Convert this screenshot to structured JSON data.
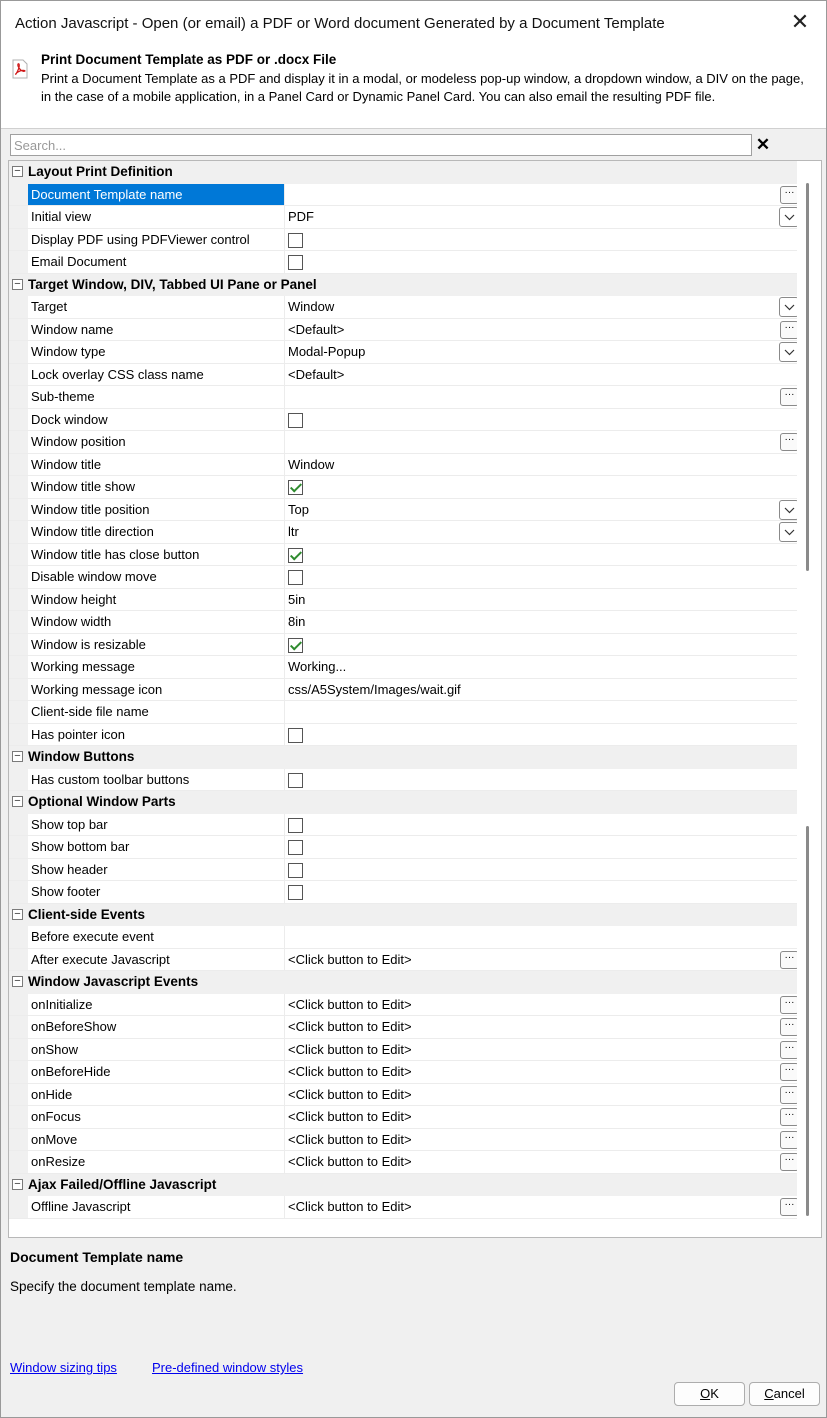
{
  "window": {
    "title": "Action Javascript - Open (or email) a PDF or Word document Generated by a Document Template"
  },
  "header": {
    "title": "Print Document Template as PDF or .docx File",
    "description": "Print a Document Template as a PDF and display it in a modal, or modeless pop-up window, a dropdown window, a DIV on the page, in the case of a mobile application, in a Panel Card or Dynamic Panel Card. You can also email the resulting PDF file."
  },
  "search": {
    "placeholder": "Search..."
  },
  "grid": {
    "rows": [
      {
        "kind": "cat",
        "label": "Layout Print Definition"
      },
      {
        "kind": "prop",
        "name": "Document Template name",
        "value": "",
        "control": "ellipsis",
        "selected": true
      },
      {
        "kind": "prop",
        "name": "Initial view",
        "value": "PDF",
        "control": "dropdown"
      },
      {
        "kind": "prop",
        "name": "Display PDF using PDFViewer control",
        "control": "checkbox",
        "checked": false
      },
      {
        "kind": "prop",
        "name": "Email Document",
        "control": "checkbox",
        "checked": false
      },
      {
        "kind": "cat",
        "label": "Target Window, DIV, Tabbed UI Pane or Panel"
      },
      {
        "kind": "prop",
        "name": "Target",
        "value": "Window",
        "control": "dropdown"
      },
      {
        "kind": "prop",
        "name": "Window name",
        "value": "<Default>",
        "control": "ellipsis"
      },
      {
        "kind": "prop",
        "name": "Window type",
        "value": "Modal-Popup",
        "control": "dropdown"
      },
      {
        "kind": "prop",
        "name": "Lock overlay CSS class name",
        "value": "<Default>"
      },
      {
        "kind": "prop",
        "name": "Sub-theme",
        "value": "",
        "control": "ellipsis"
      },
      {
        "kind": "prop",
        "name": "Dock window",
        "control": "checkbox",
        "checked": false
      },
      {
        "kind": "prop",
        "name": "Window position",
        "value": "",
        "control": "ellipsis"
      },
      {
        "kind": "prop",
        "name": "Window title",
        "value": "Window"
      },
      {
        "kind": "prop",
        "name": "Window title show",
        "control": "checkbox",
        "checked": true
      },
      {
        "kind": "prop",
        "name": "Window title position",
        "value": "Top",
        "control": "dropdown"
      },
      {
        "kind": "prop",
        "name": "Window title direction",
        "value": "ltr",
        "control": "dropdown"
      },
      {
        "kind": "prop",
        "name": "Window title has close button",
        "control": "checkbox",
        "checked": true
      },
      {
        "kind": "prop",
        "name": "Disable window move",
        "control": "checkbox",
        "checked": false
      },
      {
        "kind": "prop",
        "name": "Window height",
        "value": "5in"
      },
      {
        "kind": "prop",
        "name": "Window width",
        "value": "8in"
      },
      {
        "kind": "prop",
        "name": "Window is resizable",
        "control": "checkbox",
        "checked": true
      },
      {
        "kind": "prop",
        "name": "Working message",
        "value": "Working..."
      },
      {
        "kind": "prop",
        "name": "Working message icon",
        "value": "css/A5System/Images/wait.gif"
      },
      {
        "kind": "prop",
        "name": "Client-side file name",
        "value": ""
      },
      {
        "kind": "prop",
        "name": "Has pointer icon",
        "control": "checkbox",
        "checked": false
      },
      {
        "kind": "cat",
        "label": "Window Buttons"
      },
      {
        "kind": "prop",
        "name": "Has custom toolbar buttons",
        "control": "checkbox",
        "checked": false
      },
      {
        "kind": "cat",
        "label": "Optional Window Parts"
      },
      {
        "kind": "prop",
        "name": "Show top bar",
        "control": "checkbox",
        "checked": false
      },
      {
        "kind": "prop",
        "name": "Show bottom bar",
        "control": "checkbox",
        "checked": false
      },
      {
        "kind": "prop",
        "name": "Show header",
        "control": "checkbox",
        "checked": false
      },
      {
        "kind": "prop",
        "name": "Show footer",
        "control": "checkbox",
        "checked": false
      },
      {
        "kind": "cat",
        "label": "Client-side Events"
      },
      {
        "kind": "prop",
        "name": "Before execute event",
        "value": ""
      },
      {
        "kind": "prop",
        "name": "After execute Javascript",
        "value": "<Click button to Edit>",
        "control": "ellipsis"
      },
      {
        "kind": "cat",
        "label": "Window Javascript Events"
      },
      {
        "kind": "prop",
        "name": "onInitialize",
        "value": "<Click button to Edit>",
        "control": "ellipsis"
      },
      {
        "kind": "prop",
        "name": "onBeforeShow",
        "value": "<Click button to Edit>",
        "control": "ellipsis"
      },
      {
        "kind": "prop",
        "name": "onShow",
        "value": "<Click button to Edit>",
        "control": "ellipsis"
      },
      {
        "kind": "prop",
        "name": "onBeforeHide",
        "value": "<Click button to Edit>",
        "control": "ellipsis"
      },
      {
        "kind": "prop",
        "name": "onHide",
        "value": "<Click button to Edit>",
        "control": "ellipsis"
      },
      {
        "kind": "prop",
        "name": "onFocus",
        "value": "<Click button to Edit>",
        "control": "ellipsis"
      },
      {
        "kind": "prop",
        "name": "onMove",
        "value": "<Click button to Edit>",
        "control": "ellipsis"
      },
      {
        "kind": "prop",
        "name": "onResize",
        "value": "<Click button to Edit>",
        "control": "ellipsis"
      },
      {
        "kind": "cat",
        "label": "Ajax Failed/Offline Javascript"
      },
      {
        "kind": "prop",
        "name": "Offline Javascript",
        "value": "<Click button to Edit>",
        "control": "ellipsis"
      }
    ]
  },
  "help": {
    "title": "Document Template name",
    "text": "Specify the document template name."
  },
  "links": {
    "sizing_tips": "Window sizing tips",
    "predefined_styles": "Pre-defined window styles"
  },
  "buttons": {
    "ok": {
      "accel": "O",
      "rest": "K"
    },
    "cancel": {
      "accel": "C",
      "rest": "ancel"
    }
  },
  "icons": {
    "close": "close-icon",
    "pdf": "pdf-file-icon",
    "collapse": "collapse-minus-icon",
    "ellipsis": "ellipsis-icon",
    "dropdown": "chevron-down-icon",
    "check": "checkmark-icon"
  },
  "colors": {
    "selection": "#0078d7",
    "link": "#0000ee",
    "check": "#2e8b2e"
  }
}
